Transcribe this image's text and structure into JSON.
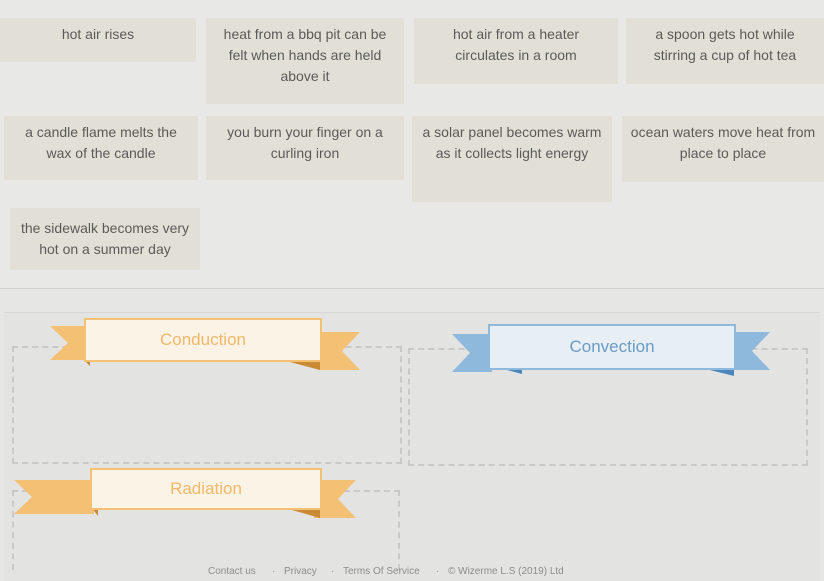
{
  "cards": [
    "hot air rises",
    "heat from a bbq pit can be felt when hands are held above it",
    "hot air from a heater circulates in a room",
    "a spoon gets hot while stirring a cup of hot tea",
    "a candle flame melts the wax of the candle",
    "you burn your finger on a curling iron",
    "a solar panel becomes warm as it collects light energy",
    "ocean waters move heat from place to place",
    "the sidewalk becomes very hot on a summer day"
  ],
  "categories": {
    "conduction": "Conduction",
    "convection": "Convection",
    "radiation": "Radiation"
  },
  "footer": {
    "contact": "Contact us",
    "sep": "·",
    "privacy": "Privacy",
    "terms": "Terms Of Service",
    "copyright": "© Wizerme L.S (2019) Ltd"
  },
  "colors": {
    "card_bg": "#e2e0d6",
    "orange_ribbon": "#f3c074",
    "blue_ribbon": "#8fb8dd"
  }
}
